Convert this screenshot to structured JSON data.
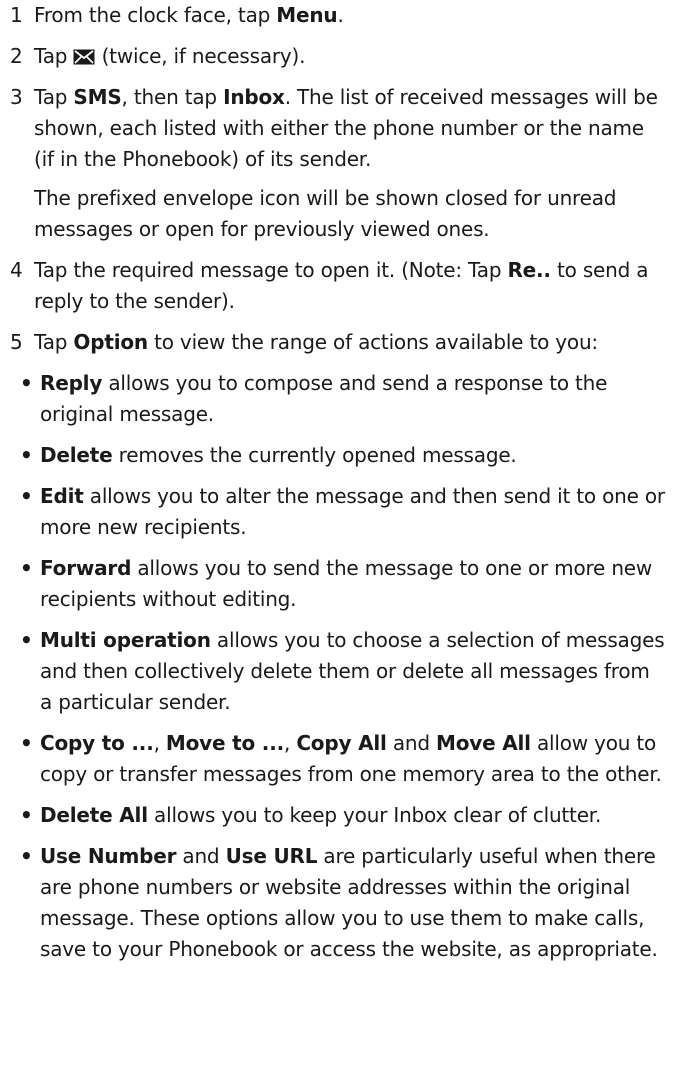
{
  "steps": [
    {
      "num": "1",
      "pre": "From the clock face, tap ",
      "bold": "Menu",
      "post": "."
    },
    {
      "num": "2",
      "pre": "Tap ",
      "icon": "envelope-icon",
      "post": " (twice, if necessary)."
    },
    {
      "num": "3",
      "pre": "Tap ",
      "bold": "SMS",
      "mid": ", then tap ",
      "bold2": "Inbox",
      "post": ". The list of received messages will be shown, each listed with either the phone number or the name (if in the Phonebook) of its sender.",
      "sub": "The prefixed envelope icon will be shown closed for unread messages or open for previously viewed ones."
    },
    {
      "num": "4",
      "pre": "Tap the required message to open it. (Note: Tap ",
      "bold": "Re..",
      "post": " to send a reply to the sender)."
    },
    {
      "num": "5",
      "pre": "Tap ",
      "bold": "Option",
      "post": " to view the range of actions available to you:"
    }
  ],
  "bullets": [
    {
      "b1": "Reply",
      "text": " allows you to compose and send a response to the original message."
    },
    {
      "b1": "Delete",
      "text": " removes the currently opened message."
    },
    {
      "b1": "Edit",
      "text": " allows you to alter the message and then send it to one or more new recipients."
    },
    {
      "b1": "Forward",
      "text": " allows you to send the message to one or more new recipients without editing."
    },
    {
      "b1": "Multi operation",
      "text": " allows you to choose a selection of messages and then collectively delete them or delete all messages from a particular sender."
    },
    {
      "b1": "Copy to ...",
      "s1": ", ",
      "b2": "Move to ...",
      "s2": ", ",
      "b3": "Copy All",
      "s3": " and ",
      "b4": "Move All",
      "text": " allow you to copy or transfer messages from one memory area to the other."
    },
    {
      "b1": "Delete All",
      "text": " allows you to keep your Inbox clear of clutter."
    },
    {
      "b1": "Use Number",
      "s1": " and ",
      "b2": "Use URL",
      "text": " are particularly useful when there are phone numbers or website addresses within the original message. These options allow you to use them to make calls, save to your Phonebook or access the website, as appropriate."
    }
  ],
  "bullet_symbol": "•"
}
